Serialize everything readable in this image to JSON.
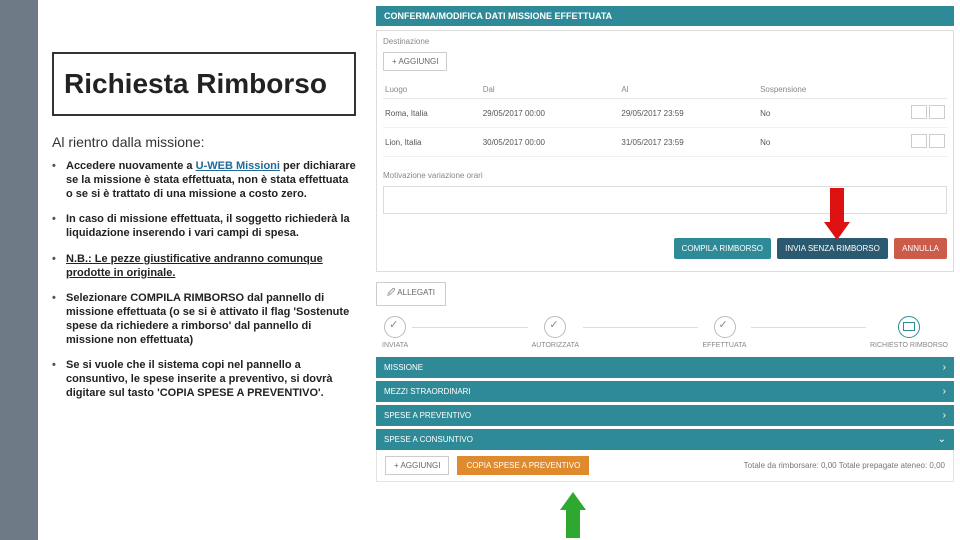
{
  "title": "Richiesta Rimborso",
  "subtitle": "Al rientro dalla missione:",
  "bullets": {
    "b1a": "Accedere nuovamente a ",
    "b1link": "U-WEB Missioni",
    "b1b": " per dichiarare se la missione è stata effettuata, non è stata effettuata o se si è trattato di una missione a costo zero.",
    "b2": "In caso di missione effettuata, il soggetto richiederà la liquidazione inserendo i vari campi di spesa.",
    "b3": "N.B.: Le pezze giustificative andranno comunque prodotte in originale.",
    "b4": "Selezionare COMPILA RIMBORSO dal pannello di missione effettuata (o se si è attivato il flag 'Sostenute spese da richiedere a rimborso' dal pannello di missione non effettuata)",
    "b5": "Se si vuole che il sistema copi nel pannello a consuntivo, le spese inserite a preventivo, si dovrà digitare sul tasto 'COPIA SPESE A PREVENTIVO'."
  },
  "panel": {
    "header": "CONFERMA/MODIFICA DATI MISSIONE EFFETTUATA",
    "section1": "Destinazione",
    "addBtn": "+ AGGIUNGI",
    "cols": {
      "c1": "Luogo",
      "c2": "Dal",
      "c3": "Al",
      "c4": "Sospensione"
    },
    "rows": [
      {
        "luogo": "Roma, Italia",
        "dal": "29/05/2017 00:00",
        "al": "29/05/2017 23:59",
        "sosp": "No"
      },
      {
        "luogo": "Lion, Italia",
        "dal": "30/05/2017 00:00",
        "al": "31/05/2017 23:59",
        "sosp": "No"
      }
    ],
    "motivLabel": "Motivazione variazione orari",
    "btnCompila": "COMPILA RIMBORSO",
    "btnInvia": "INVIA SENZA RIMBORSO",
    "btnAnnulla": "ANNULLA",
    "attach": "🖉 ALLEGATI",
    "steps": {
      "s1": "INVIATA",
      "s2": "AUTORIZZATA",
      "s3": "EFFETTUATA",
      "s4": "RICHIESTO RIMBORSO"
    },
    "acc": {
      "a1": "MISSIONE",
      "a2": "MEZZI STRAORDINARI",
      "a3": "SPESE A PREVENTIVO",
      "a4": "SPESE A CONSUNTIVO"
    },
    "addBtn2": "+ AGGIUNGI",
    "copyBtn": "COPIA SPESE A PREVENTIVO",
    "totals": "Totale da rimborsare: 0,00    Totale prepagate ateneo: 0,00"
  }
}
